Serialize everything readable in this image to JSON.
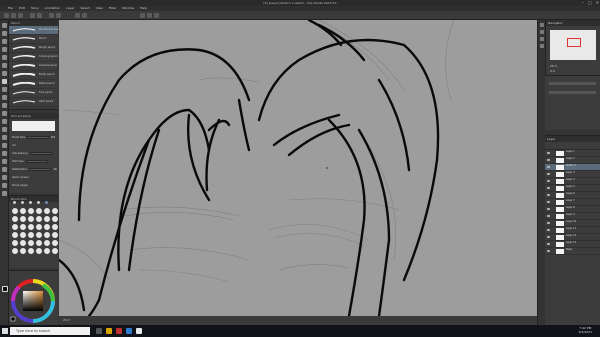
{
  "window": {
    "title": "[5] [Layer] Sketch 1 sketch - Clip Studio Paint EX",
    "min": "–",
    "max": "□",
    "close": "✕"
  },
  "menu": [
    "File",
    "Edit",
    "Story",
    "Animation",
    "Layer",
    "Select",
    "View",
    "Filter",
    "Window",
    "Help"
  ],
  "subtool": {
    "title": "Pencil",
    "brushes": [
      "Mechanical pencil",
      "Pencil",
      "Rough pencil",
      "Coloring pencil",
      "Colored pencil",
      "Brush pencil",
      "Pastel pencil",
      "Fine pencil",
      "Hard pencil"
    ]
  },
  "tool_property": {
    "title": "Tool property",
    "rows": [
      {
        "label": "Brush Size",
        "value": "6.0"
      },
      {
        "label": "Ink",
        "value": ""
      },
      {
        "label": "Anti-aliasing",
        "value": ""
      },
      {
        "label": "Hardness",
        "value": ""
      },
      {
        "label": "Stabilization",
        "value": "10"
      },
      {
        "label": "Vector eraser",
        "value": ""
      },
      {
        "label": "Sharp edges",
        "value": ""
      }
    ]
  },
  "brush_size": {
    "title": "Brush size"
  },
  "navigator": {
    "title": "Navigator",
    "zoom": "28.3",
    "angle": "0.0"
  },
  "layers": {
    "title": "Layer",
    "items": [
      "Layer 1",
      "Layer 2",
      "Sketch 1",
      "Layer 3",
      "Layer 4",
      "Layer 5",
      "Layer 6",
      "Layer 7",
      "Layer 8",
      "Layer 9",
      "Layer 10",
      "Layer 11",
      "Layer 12",
      "Layer 13",
      "Paper"
    ]
  },
  "status": {
    "zoom": "28.3"
  },
  "taskbar": {
    "search_placeholder": "Type here to search",
    "time": "7:42 PM",
    "date": "3/3/2021"
  },
  "colors": {
    "canvas": "#9d9d9d",
    "line": "#0a0a0a",
    "panel": "#3c3c3c",
    "accent": "#5a6c7c"
  }
}
